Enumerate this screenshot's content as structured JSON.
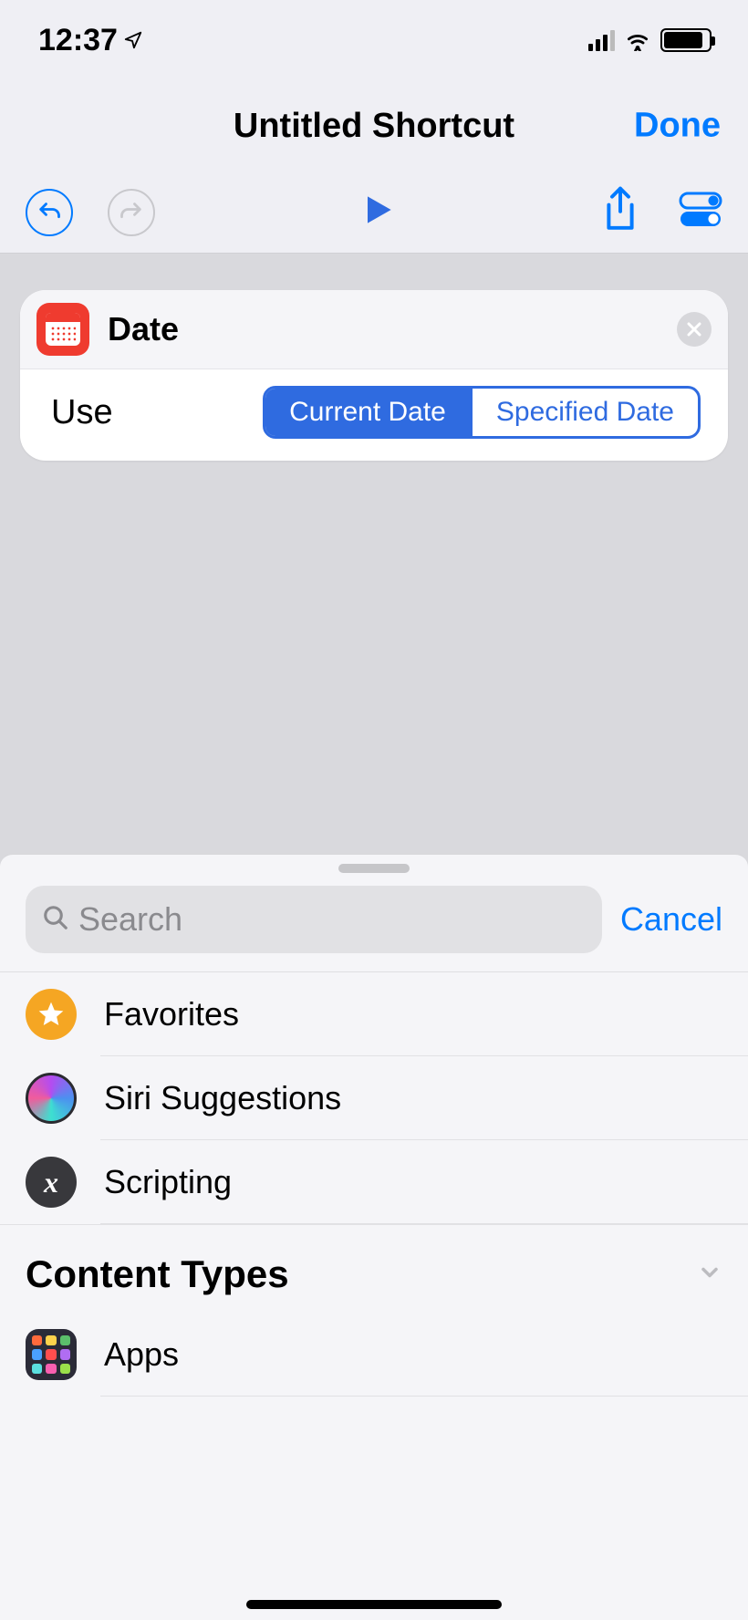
{
  "status": {
    "time": "12:37"
  },
  "nav": {
    "title": "Untitled Shortcut",
    "done": "Done"
  },
  "action": {
    "title": "Date",
    "param_label": "Use",
    "options": [
      "Current Date",
      "Specified Date"
    ],
    "selected_index": 0
  },
  "sheet": {
    "search_placeholder": "Search",
    "cancel": "Cancel",
    "items": [
      {
        "label": "Favorites"
      },
      {
        "label": "Siri Suggestions"
      },
      {
        "label": "Scripting"
      }
    ],
    "section_header": "Content Types",
    "apps_label": "Apps"
  }
}
